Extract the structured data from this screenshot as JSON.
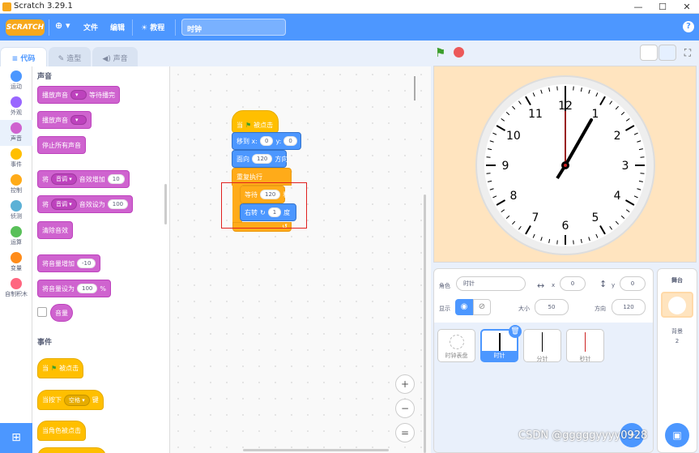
{
  "window": {
    "title": "Scratch 3.29.1",
    "min": "—",
    "max": "☐",
    "close": "✕"
  },
  "menubar": {
    "logo": "SCRATCH",
    "globe": "⊕ ▾",
    "file": "文件",
    "edit": "编辑",
    "tutorials": "教程",
    "project_name": "时钟",
    "help": "?"
  },
  "tabs": {
    "code": "代码",
    "costumes": "造型",
    "sounds": "声音"
  },
  "categories": [
    {
      "label": "运动",
      "color": "#4c97ff"
    },
    {
      "label": "外观",
      "color": "#9966ff"
    },
    {
      "label": "声音",
      "color": "#cf63cf"
    },
    {
      "label": "事件",
      "color": "#ffbf00"
    },
    {
      "label": "控制",
      "color": "#ffab19"
    },
    {
      "label": "侦测",
      "color": "#5cb1d6"
    },
    {
      "label": "运算",
      "color": "#59c059"
    },
    {
      "label": "变量",
      "color": "#ff8c1a"
    },
    {
      "label": "自制积木",
      "color": "#ff6680"
    }
  ],
  "palette": {
    "sound_header": "声音",
    "play_until_done": "播放声音",
    "until_done_suffix": "等待播完",
    "start_sound": "播放声音",
    "stop_all": "停止所有声音",
    "change_effect": "将",
    "effect_name": "音调 ▾",
    "change_effect_suffix": "音效增加",
    "change_effect_val": "10",
    "set_effect": "将",
    "set_effect_suffix": "音效设为",
    "set_effect_val": "100",
    "clear_effects": "清除音效",
    "change_volume": "将音量增加",
    "change_volume_val": "-10",
    "set_volume": "将音量设为",
    "set_volume_val": "100",
    "set_volume_unit": "%",
    "volume_reporter": "音量",
    "events_header": "事件",
    "when_flag": "当",
    "when_flag_suffix": "被点击",
    "when_key": "当按下",
    "key_name": "空格 ▾",
    "when_key_suffix": "键",
    "when_sprite_clicked": "当角色被点击"
  },
  "script": {
    "hat": "当",
    "hat_suffix": "被点击",
    "goto": "移到 x:",
    "goto_x": "0",
    "goto_y_label": "y:",
    "goto_y": "0",
    "point": "面向",
    "point_val": "120",
    "point_suffix": "方向",
    "forever": "重复执行",
    "wait": "等待",
    "wait_val": "120",
    "wait_unit": "秒",
    "turn": "右转",
    "turn_val": "1",
    "turn_unit": "度"
  },
  "zoom": {
    "in": "+",
    "out": "−",
    "reset": "="
  },
  "stage": {
    "numbers": [
      "12",
      "1",
      "2",
      "3",
      "4",
      "5",
      "6",
      "7",
      "8",
      "9",
      "10",
      "11"
    ]
  },
  "sprite_info": {
    "sprite_label": "角色",
    "sprite_name": "时针",
    "x_label": "x",
    "x": "0",
    "y_label": "y",
    "y": "0",
    "show_label": "显示",
    "size_label": "大小",
    "size": "50",
    "direction_label": "方向",
    "direction": "120"
  },
  "sprites": [
    {
      "name": "时钟表盘",
      "selected": false
    },
    {
      "name": "时针",
      "selected": true
    },
    {
      "name": "分针",
      "selected": false
    },
    {
      "name": "秒针",
      "selected": false
    }
  ],
  "stage_panel": {
    "title": "舞台",
    "backdrops_label": "背景",
    "backdrops_count": "2"
  },
  "watermark": "CSDN @gggggyyyy0928"
}
